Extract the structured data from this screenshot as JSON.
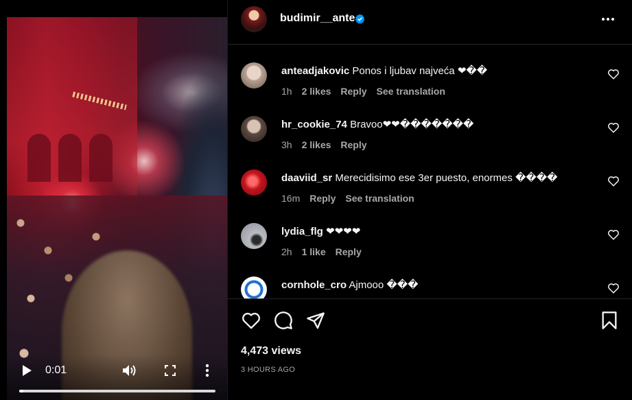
{
  "video": {
    "time": "0:01",
    "progress": 0.02,
    "icons": {
      "play": "play-icon",
      "volume": "volume-icon",
      "fullscreen": "fullscreen-icon",
      "more": "more-vertical-icon"
    }
  },
  "post": {
    "username": "budimir__ante",
    "verified": true,
    "more_icon": "more-horizontal-icon"
  },
  "comments": [
    {
      "user": "anteadjakovic",
      "text": "Ponos i ljubav najveća ❤��",
      "time": "1h",
      "likes": "2 likes",
      "reply": "Reply",
      "translate": "See translation"
    },
    {
      "user": "hr_cookie_74",
      "text": "Bravoo❤❤�������",
      "time": "3h",
      "likes": "2 likes",
      "reply": "Reply",
      "translate": ""
    },
    {
      "user": "daaviid_sr",
      "text": "Merecidisimo ese 3er puesto, enormes ����",
      "time": "16m",
      "likes": "",
      "reply": "Reply",
      "translate": "See translation"
    },
    {
      "user": "lydia_flg",
      "text": "❤❤❤❤",
      "time": "2h",
      "likes": "1 like",
      "reply": "Reply",
      "translate": ""
    },
    {
      "user": "cornhole_cro",
      "text": "Ajmooo ���",
      "time": "",
      "likes": "",
      "reply": "",
      "translate": ""
    }
  ],
  "actions": {
    "views": "4,473 views",
    "posted": "3 HOURS AGO",
    "icons": {
      "like": "heart-icon",
      "comment": "comment-icon",
      "share": "share-icon",
      "save": "bookmark-icon"
    }
  },
  "colors": {
    "background": "#000000",
    "text": "#f5f5f5",
    "muted": "#a8a8a8",
    "verified": "#0095f6",
    "divider": "#262626"
  }
}
